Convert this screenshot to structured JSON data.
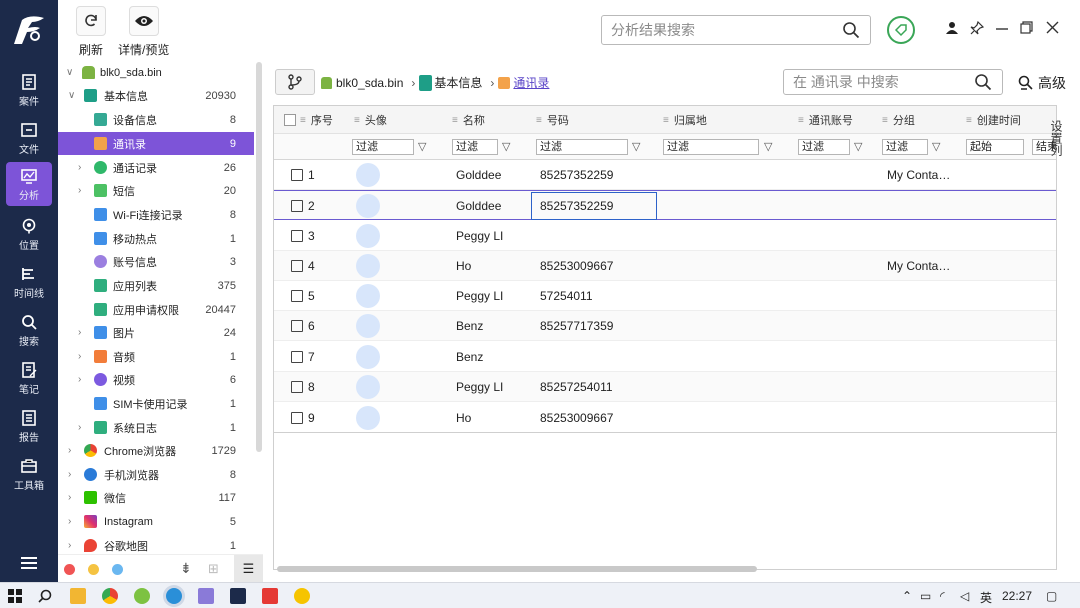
{
  "nav": {
    "items": [
      {
        "label": "案件",
        "icon": "case-icon"
      },
      {
        "label": "文件",
        "icon": "folder-icon"
      },
      {
        "label": "分析",
        "icon": "analysis-icon"
      },
      {
        "label": "位置",
        "icon": "location-icon"
      },
      {
        "label": "时间线",
        "icon": "timeline-icon"
      },
      {
        "label": "搜索",
        "icon": "search-icon"
      },
      {
        "label": "笔记",
        "icon": "note-icon"
      },
      {
        "label": "报告",
        "icon": "report-icon"
      },
      {
        "label": "工具箱",
        "icon": "toolbox-icon"
      }
    ]
  },
  "toolbar": {
    "refresh_label": "刷新",
    "details_label": "详情/预览",
    "search_placeholder": "分析结果搜索"
  },
  "tree": {
    "items": [
      {
        "label": "blk0_sda.bin",
        "count": "",
        "icon": "android-icon"
      },
      {
        "label": "基本信息",
        "count": "20930",
        "icon": "info-icon"
      },
      {
        "label": "设备信息",
        "count": "8",
        "icon": "device-icon"
      },
      {
        "label": "通讯录",
        "count": "9",
        "icon": "contacts-icon"
      },
      {
        "label": "通话记录",
        "count": "26",
        "icon": "phone-icon"
      },
      {
        "label": "短信",
        "count": "20",
        "icon": "sms-icon"
      },
      {
        "label": "Wi-Fi连接记录",
        "count": "8",
        "icon": "wifi-icon"
      },
      {
        "label": "移动热点",
        "count": "1",
        "icon": "hotspot-icon"
      },
      {
        "label": "账号信息",
        "count": "3",
        "icon": "account-icon"
      },
      {
        "label": "应用列表",
        "count": "375",
        "icon": "app-list-icon"
      },
      {
        "label": "应用申请权限",
        "count": "20447",
        "icon": "permission-icon"
      },
      {
        "label": "图片",
        "count": "24",
        "icon": "image-icon"
      },
      {
        "label": "音频",
        "count": "1",
        "icon": "audio-icon"
      },
      {
        "label": "视频",
        "count": "6",
        "icon": "video-icon"
      },
      {
        "label": "SIM卡使用记录",
        "count": "1",
        "icon": "sim-icon"
      },
      {
        "label": "系统日志",
        "count": "1",
        "icon": "log-icon"
      },
      {
        "label": "Chrome浏览器",
        "count": "1729",
        "icon": "chrome-icon"
      },
      {
        "label": "手机浏览器",
        "count": "8",
        "icon": "browser-icon"
      },
      {
        "label": "微信",
        "count": "117",
        "icon": "wechat-icon"
      },
      {
        "label": "Instagram",
        "count": "5",
        "icon": "instagram-icon"
      },
      {
        "label": "谷歌地图",
        "count": "1",
        "icon": "maps-icon"
      }
    ]
  },
  "breadcrumb": {
    "items": [
      "blk0_sda.bin",
      "基本信息",
      "通讯录"
    ]
  },
  "list_search": {
    "placeholder": "在 通讯录 中搜索",
    "advanced_label": "高级"
  },
  "table": {
    "columns": [
      "序号",
      "头像",
      "名称",
      "号码",
      "归属地",
      "通讯账号",
      "分组",
      "创建时间"
    ],
    "filter_placeholder": "过滤",
    "date_from": "起始",
    "date_to": "结束",
    "rows": [
      {
        "index": "1",
        "name": "Golddee",
        "number": "85257352259",
        "group": "My Conta…"
      },
      {
        "index": "2",
        "name": "Golddee",
        "number": "85257352259",
        "group": ""
      },
      {
        "index": "3",
        "name": "Peggy LI",
        "number": "",
        "group": ""
      },
      {
        "index": "4",
        "name": "Ho",
        "number": "85253009667",
        "group": "My Conta…"
      },
      {
        "index": "5",
        "name": "Peggy LI",
        "number": "57254011",
        "group": ""
      },
      {
        "index": "6",
        "name": "Benz",
        "number": "85257717359",
        "group": ""
      },
      {
        "index": "7",
        "name": "Benz",
        "number": "",
        "group": ""
      },
      {
        "index": "8",
        "name": "Peggy LI",
        "number": "85257254011",
        "group": ""
      },
      {
        "index": "9",
        "name": "Ho",
        "number": "85253009667",
        "group": ""
      }
    ]
  },
  "side_panel": {
    "label": "设置列"
  },
  "taskbar": {
    "time": "22:27",
    "ime": "英"
  },
  "colors": {
    "accent": "#7d54d8",
    "nav_bg": "#1c2a4a",
    "selection_border": "#2d62c9"
  }
}
